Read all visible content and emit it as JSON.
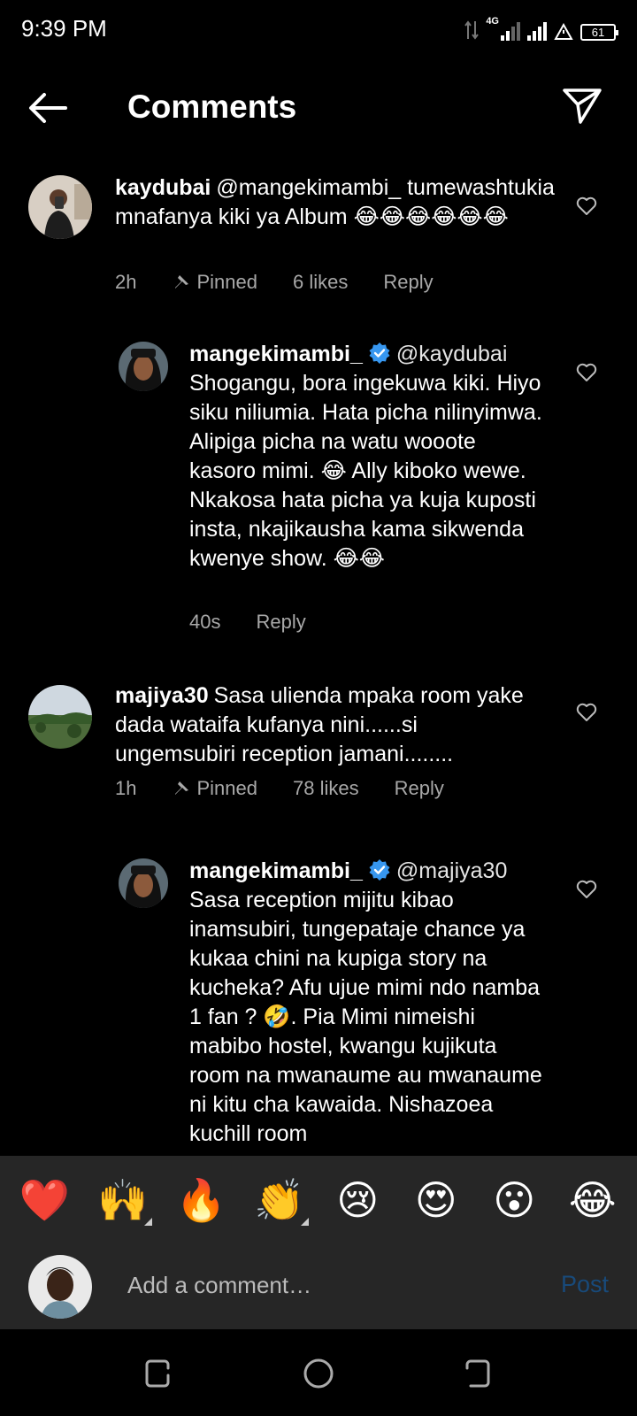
{
  "status": {
    "time": "9:39 PM",
    "network": "4G",
    "battery": "61"
  },
  "header": {
    "title": "Comments"
  },
  "comments": [
    {
      "username": "kaydubai",
      "text": "@mangekimambi_ tumewashtukia mnafanya kiki ya Album 😂😂😂😂😂😂",
      "time": "2h",
      "pinned": "Pinned",
      "likes": "6 likes",
      "reply": "Reply"
    },
    {
      "username": "mangekimambi_",
      "mention": "@kaydubai",
      "text": "Shogangu, bora ingekuwa kiki. Hiyo siku niliumia. Hata picha nilinyimwa. Alipiga picha na watu wooote kasoro mimi. 😂 Ally kiboko wewe. Nkakosa hata picha ya kuja kuposti insta, nkajikausha kama sikwenda kwenye show. 😂😂",
      "time": "40s",
      "reply": "Reply"
    },
    {
      "username": "majiya30",
      "text": "Sasa ulienda mpaka room yake dada wataifa kufanya nini......si ungemsubiri reception jamani........",
      "time": "1h",
      "pinned": "Pinned",
      "likes": "78 likes",
      "reply": "Reply"
    },
    {
      "username": "mangekimambi_",
      "mention": "@majiya30",
      "text": "Sasa reception mijitu kibao inamsubiri, tungepataje chance ya kukaa chini na kupiga story na kucheka? Afu ujue mimi ndo namba 1 fan ? 🤣. Pia Mimi nimeishi mabibo hostel, kwangu kujikuta  room na mwanaume au mwanaume ni kitu cha kawaida. Nishazoea kuchill room"
    }
  ],
  "emojis": [
    "❤️",
    "🙌",
    "🔥",
    "👏",
    "😢",
    "😍",
    "😮",
    "😂"
  ],
  "compose": {
    "placeholder": "Add a comment…",
    "post": "Post"
  },
  "colors": {
    "background": "#000000",
    "panel": "#262626",
    "meta": "#a8a8a8",
    "post_disabled": "#184a7a",
    "verified": "#3797f0"
  }
}
